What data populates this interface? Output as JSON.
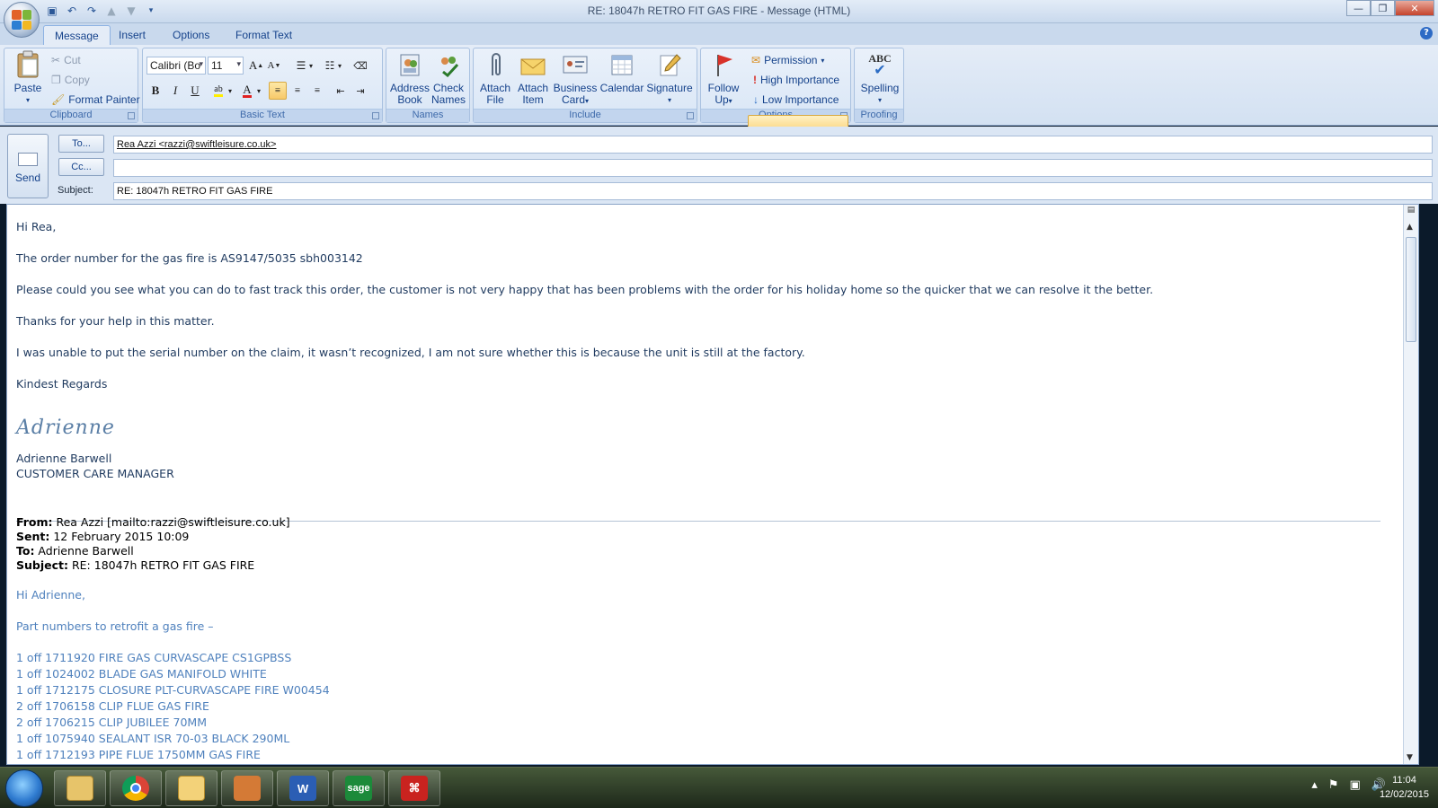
{
  "window": {
    "title": "RE: 18047h RETRO FIT GAS FIRE - Message (HTML)",
    "controls": {
      "minimize": "—",
      "maximize": "❐",
      "close": "✕"
    }
  },
  "tabs": [
    "Message",
    "Insert",
    "Options",
    "Format Text"
  ],
  "ribbon": {
    "clipboard": {
      "label": "Clipboard",
      "paste": "Paste",
      "cut": "Cut",
      "copy": "Copy",
      "format_painter": "Format Painter"
    },
    "basic_text": {
      "label": "Basic Text",
      "font": "Calibri (Bo",
      "size": "11",
      "bold": "B",
      "italic": "I",
      "underline": "U",
      "grow": "A",
      "shrink": "A"
    },
    "names": {
      "label": "Names",
      "address_book_1": "Address",
      "address_book_2": "Book",
      "check_names_1": "Check",
      "check_names_2": "Names"
    },
    "include": {
      "label": "Include",
      "attach_file_1": "Attach",
      "attach_file_2": "File",
      "attach_item_1": "Attach",
      "attach_item_2": "Item",
      "business_card_1": "Business",
      "business_card_2": "Card",
      "calendar": "Calendar",
      "signature": "Signature"
    },
    "options": {
      "label": "Options",
      "follow_up_1": "Follow",
      "follow_up_2": "Up",
      "permission": "Permission",
      "high_importance": "High Importance",
      "low_importance": "Low Importance"
    },
    "proofing": {
      "label": "Proofing",
      "abc": "ABC",
      "spelling": "Spelling"
    }
  },
  "header": {
    "send": "Send",
    "to_button": "To...",
    "cc_button": "Cc...",
    "subject_label": "Subject:",
    "to_value": "Rea Azzi <razzi@swiftleisure.co.uk>",
    "cc_value": "",
    "subject_value": "RE: 18047h RETRO FIT GAS FIRE"
  },
  "body": {
    "greeting": "Hi Rea,",
    "p1": "The order number for the gas fire is AS9147/5035 sbh003142",
    "p2": "Please could you see what you can do to fast track this order, the customer is not very happy that has been problems with the order for his holiday home so the quicker that we can resolve it the better.",
    "p3": "Thanks for your help in this matter.",
    "p4": "I was unable to put the serial number on the claim, it wasn’t recognized, I am not sure whether this is because the unit is still at the factory.",
    "closing": "Kindest Regards",
    "signature_script": "Adrienne",
    "sig_name": "Adrienne Barwell",
    "sig_title": "CUSTOMER CARE MANAGER",
    "quoted": {
      "from_label": "From:",
      "from_value": " Rea Azzi [mailto:razzi@swiftleisure.co.uk]",
      "sent_label": "Sent:",
      "sent_value": " 12 February 2015 10:09",
      "to_label": "To:",
      "to_value": " Adrienne Barwell",
      "subject_label": "Subject:",
      "subject_value": " RE: 18047h RETRO FIT GAS FIRE",
      "greeting": "Hi Adrienne,",
      "intro": "Part numbers to retrofit a gas fire –",
      "parts": [
        "1 off 1711920 FIRE GAS CURVASCAPE CS1GPBSS",
        "1 off 1024002 BLADE GAS MANIFOLD WHITE",
        "1 off 1712175 CLOSURE PLT-CURVASCAPE FIRE W00454",
        "2 off 1706158 CLIP FLUE GAS FIRE",
        "2 off 1706215 CLIP JUBILEE 70MM",
        "1 off 1075940 SEALANT ISR 70-03 BLACK 290ML",
        "1 off 1712193 PIPE FLUE 1750MM GAS FIRE"
      ]
    }
  },
  "taskbar": {
    "apps": [
      "windows-explorer",
      "google-chrome",
      "outlook",
      "user-app",
      "microsoft-word",
      "sage",
      "adobe-reader"
    ],
    "word_letter": "W",
    "sage_text": "sage",
    "clock_time": "11:04",
    "clock_date": "12/02/2015"
  }
}
